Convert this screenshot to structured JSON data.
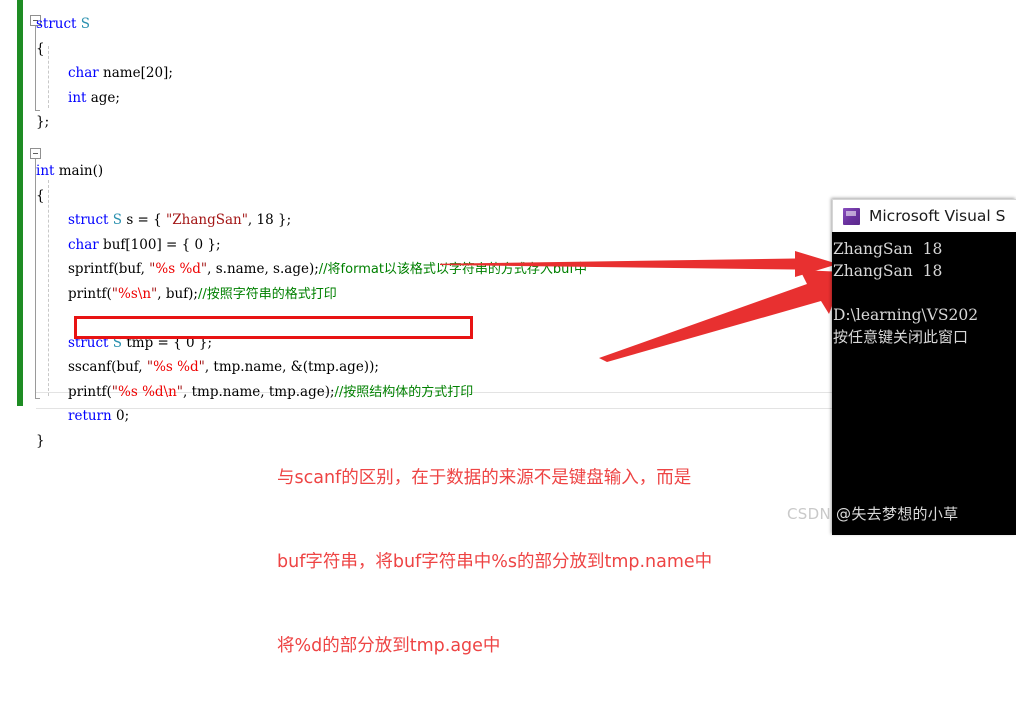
{
  "editor": {
    "change_bar_color": "#1e8c23",
    "code_lines": [
      {
        "indent": 0,
        "tokens": [
          {
            "t": "struct ",
            "c": "kw"
          },
          {
            "t": "S",
            "c": "typ"
          }
        ]
      },
      {
        "indent": 0,
        "tokens": [
          {
            "t": "{",
            "c": "plain"
          }
        ]
      },
      {
        "indent": 1,
        "tokens": [
          {
            "t": "char",
            "c": "kw"
          },
          {
            "t": " name[",
            "c": "plain"
          },
          {
            "t": "20",
            "c": "num"
          },
          {
            "t": "];",
            "c": "plain"
          }
        ]
      },
      {
        "indent": 1,
        "tokens": [
          {
            "t": "int",
            "c": "kw"
          },
          {
            "t": " age;",
            "c": "plain"
          }
        ]
      },
      {
        "indent": 0,
        "tokens": [
          {
            "t": "};",
            "c": "plain"
          }
        ]
      },
      {
        "indent": 0,
        "tokens": []
      },
      {
        "indent": 0,
        "tokens": [
          {
            "t": "int",
            "c": "kw"
          },
          {
            "t": " main()",
            "c": "plain"
          }
        ]
      },
      {
        "indent": 0,
        "tokens": [
          {
            "t": "{",
            "c": "plain"
          }
        ]
      },
      {
        "indent": 1,
        "tokens": [
          {
            "t": "struct",
            "c": "kw"
          },
          {
            "t": " ",
            "c": "plain"
          },
          {
            "t": "S",
            "c": "typ"
          },
          {
            "t": " s = { ",
            "c": "plain"
          },
          {
            "t": "\"ZhangSan\"",
            "c": "str"
          },
          {
            "t": ", ",
            "c": "plain"
          },
          {
            "t": "18",
            "c": "num"
          },
          {
            "t": " };",
            "c": "plain"
          }
        ]
      },
      {
        "indent": 1,
        "tokens": [
          {
            "t": "char",
            "c": "kw"
          },
          {
            "t": " buf[",
            "c": "plain"
          },
          {
            "t": "100",
            "c": "num"
          },
          {
            "t": "] = { ",
            "c": "plain"
          },
          {
            "t": "0",
            "c": "num"
          },
          {
            "t": " };",
            "c": "plain"
          }
        ]
      },
      {
        "indent": 1,
        "tokens": [
          {
            "t": "sprintf(buf, ",
            "c": "plain"
          },
          {
            "t": "\"",
            "c": "str"
          },
          {
            "t": "%s %d",
            "c": "fmt"
          },
          {
            "t": "\"",
            "c": "str"
          },
          {
            "t": ", s.name, s.age);",
            "c": "plain"
          },
          {
            "t": "//将format以该格式以字符串的方式存入buf中",
            "c": "cmt"
          }
        ]
      },
      {
        "indent": 1,
        "tokens": [
          {
            "t": "printf(",
            "c": "plain"
          },
          {
            "t": "\"",
            "c": "str"
          },
          {
            "t": "%s",
            "c": "fmt"
          },
          {
            "t": "\\n",
            "c": "fmt"
          },
          {
            "t": "\"",
            "c": "str"
          },
          {
            "t": ", buf);",
            "c": "plain"
          },
          {
            "t": "//按照字符串的格式打印",
            "c": "cmt"
          }
        ]
      },
      {
        "indent": 1,
        "tokens": []
      },
      {
        "indent": 1,
        "tokens": [
          {
            "t": "struct",
            "c": "kw"
          },
          {
            "t": " ",
            "c": "plain"
          },
          {
            "t": "S",
            "c": "typ"
          },
          {
            "t": " tmp = { ",
            "c": "plain"
          },
          {
            "t": "0",
            "c": "num"
          },
          {
            "t": " };",
            "c": "plain"
          }
        ]
      },
      {
        "indent": 1,
        "tokens": [
          {
            "t": "sscanf(buf, ",
            "c": "plain"
          },
          {
            "t": "\"",
            "c": "str"
          },
          {
            "t": "%s %d",
            "c": "fmt"
          },
          {
            "t": "\"",
            "c": "str"
          },
          {
            "t": ", tmp.name, &(tmp.age));",
            "c": "plain"
          }
        ]
      },
      {
        "indent": 1,
        "tokens": [
          {
            "t": "printf(",
            "c": "plain"
          },
          {
            "t": "\"",
            "c": "str"
          },
          {
            "t": "%s %d",
            "c": "fmt"
          },
          {
            "t": "\\n",
            "c": "fmt"
          },
          {
            "t": "\"",
            "c": "str"
          },
          {
            "t": ", tmp.name, tmp.age);",
            "c": "plain"
          },
          {
            "t": "//按照结构体的方式打印",
            "c": "cmt"
          }
        ]
      },
      {
        "indent": 1,
        "tokens": [
          {
            "t": "return",
            "c": "kw"
          },
          {
            "t": " ",
            "c": "plain"
          },
          {
            "t": "0",
            "c": "num"
          },
          {
            "t": ";",
            "c": "plain"
          }
        ]
      },
      {
        "indent": 0,
        "tokens": [
          {
            "t": "}",
            "c": "plain"
          }
        ]
      }
    ]
  },
  "highlight": {
    "sscanf_box_color": "#e81313"
  },
  "annotation": {
    "color": "#ee4444",
    "lines": [
      "与scanf的区别，在于数据的来源不是键盘输入，而是",
      "buf字符串，将buf字符串中%s的部分放到tmp.name中",
      "将%d的部分放到tmp.age中"
    ]
  },
  "arrows": {
    "color": "#e83030",
    "top_arrow_name": "arrow-to-first-output-line",
    "diagonal_arrow_name": "arrow-to-second-output-line"
  },
  "console": {
    "title": "Microsoft Visual S",
    "icon": "visual-studio-icon",
    "lines": [
      "ZhangSan  18",
      "ZhangSan  18",
      "",
      "D:\\learning\\VS202",
      "按任意键关闭此窗口"
    ]
  },
  "watermark": {
    "prefix": "CSDN ",
    "text": "@失去梦想的小草"
  }
}
